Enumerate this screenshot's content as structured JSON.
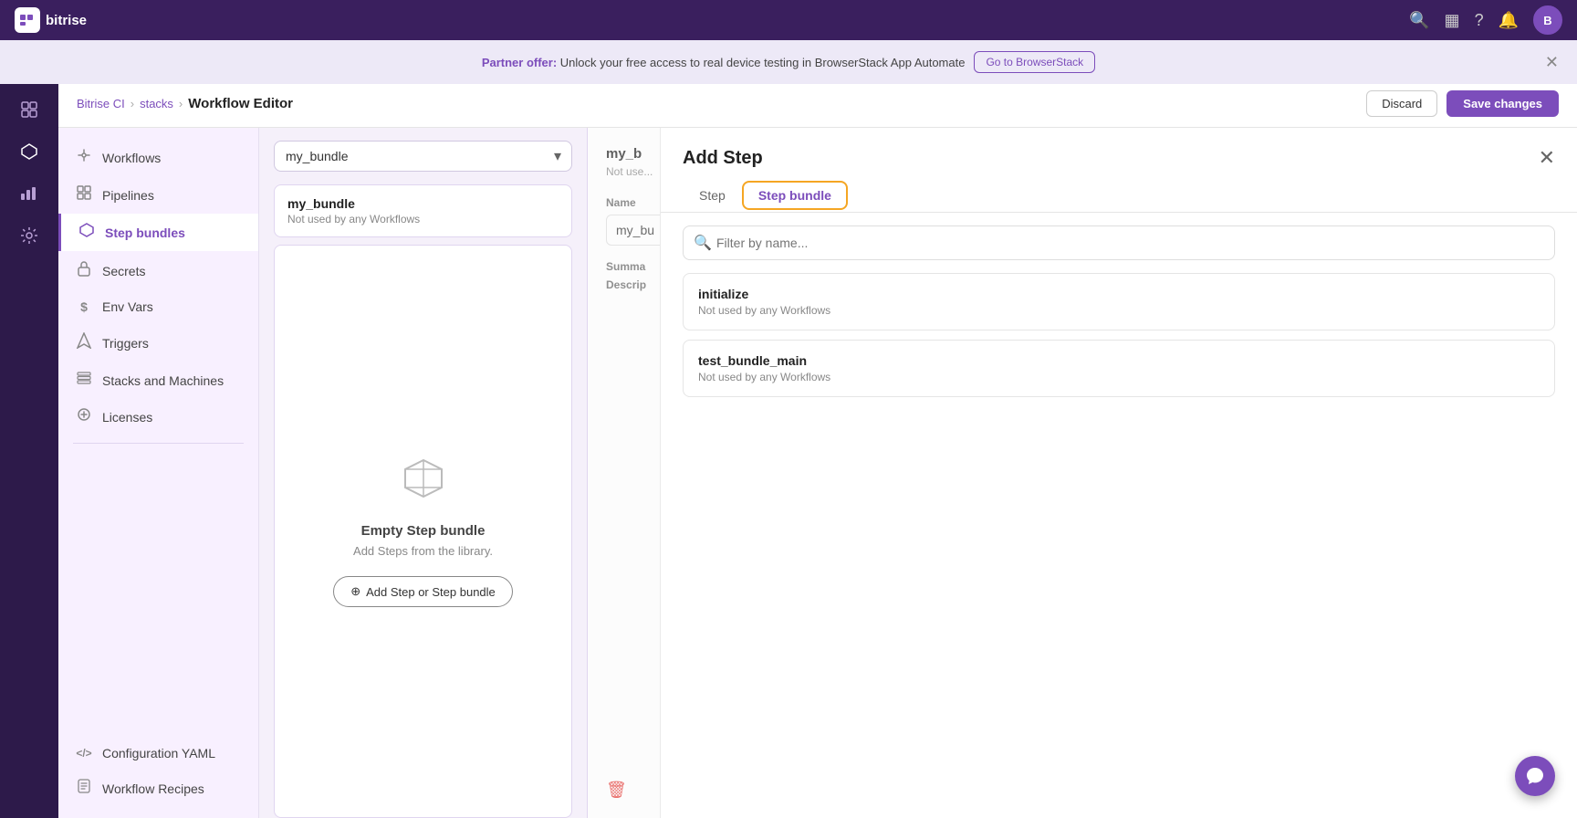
{
  "app": {
    "name": "bitrise"
  },
  "banner": {
    "text_prefix": "Partner offer:",
    "text": " Unlock your free access to real device testing in BrowserStack App Automate",
    "button_label": "Go to BrowserStack"
  },
  "breadcrumb": {
    "home": "Bitrise CI",
    "section": "stacks",
    "current": "Workflow Editor"
  },
  "actions": {
    "discard_label": "Discard",
    "save_label": "Save changes"
  },
  "nav": {
    "items": [
      {
        "id": "workflows",
        "label": "Workflows",
        "icon": "⟳"
      },
      {
        "id": "pipelines",
        "label": "Pipelines",
        "icon": "⊞"
      },
      {
        "id": "step-bundles",
        "label": "Step bundles",
        "icon": "◈",
        "active": true
      },
      {
        "id": "secrets",
        "label": "Secrets",
        "icon": "🔒"
      },
      {
        "id": "env-vars",
        "label": "Env Vars",
        "icon": "$"
      },
      {
        "id": "triggers",
        "label": "Triggers",
        "icon": "⚡"
      },
      {
        "id": "stacks-machines",
        "label": "Stacks and Machines",
        "icon": "≡"
      },
      {
        "id": "licenses",
        "label": "Licenses",
        "icon": "⊙"
      }
    ],
    "bottom_items": [
      {
        "id": "config-yaml",
        "label": "Configuration YAML",
        "icon": "</>"
      },
      {
        "id": "workflow-recipes",
        "label": "Workflow Recipes",
        "icon": "📄"
      }
    ]
  },
  "bundle_panel": {
    "dropdown_value": "my_bundle",
    "dropdown_options": [
      "my_bundle"
    ],
    "bundle": {
      "name": "my_bundle",
      "subtitle": "Not used by any Workflows"
    },
    "empty_state": {
      "title": "Empty Step bundle",
      "subtitle": "Add Steps from the library.",
      "add_button": "Add Step or Step bundle"
    }
  },
  "detail_panel": {
    "title": "my_b",
    "subtitle": "Not used...",
    "name_label": "Name",
    "name_value": "my_bu",
    "summary_label": "Summa",
    "description_label": "Descrip"
  },
  "add_step": {
    "title": "Add Step",
    "close_icon": "✕",
    "tabs": [
      {
        "id": "step",
        "label": "Step"
      },
      {
        "id": "step-bundle",
        "label": "Step bundle",
        "active": true
      }
    ],
    "search_placeholder": "Filter by name...",
    "items": [
      {
        "name": "initialize",
        "subtitle": "Not used by any Workflows"
      },
      {
        "name": "test_bundle_main",
        "subtitle": "Not used by any Workflows"
      }
    ]
  },
  "colors": {
    "brand_purple": "#7c4dbb",
    "dark_sidebar": "#2d1a4a",
    "nav_bg": "#f8f0ff"
  }
}
